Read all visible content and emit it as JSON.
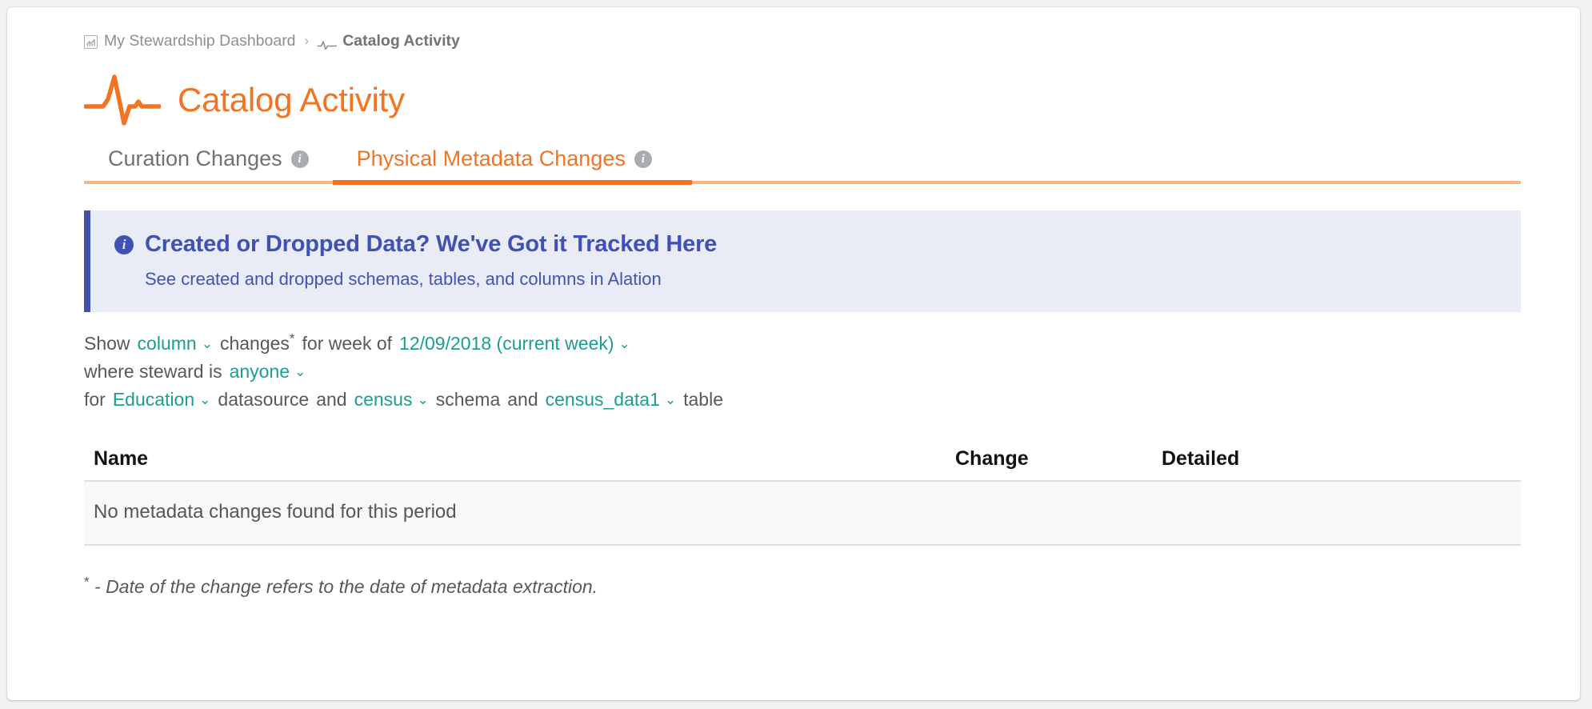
{
  "breadcrumb": {
    "dashboard_icon": "dashboard-chart-icon",
    "dashboard_label": "My Stewardship Dashboard",
    "separator": "›",
    "current_icon": "pulse-icon",
    "current_label": "Catalog Activity"
  },
  "header": {
    "icon": "pulse-icon",
    "title": "Catalog Activity",
    "accent_color": "#f37321"
  },
  "tabs": [
    {
      "label": "Curation Changes",
      "info": "i",
      "active": false
    },
    {
      "label": "Physical Metadata Changes",
      "info": "i",
      "active": true
    }
  ],
  "banner": {
    "icon": "info-circle-icon",
    "title": "Created or Dropped Data? We've Got it Tracked Here",
    "subtitle": "See created and dropped schemas, tables, and columns in Alation",
    "accent_color": "#3f51b5",
    "background_color": "#e9ecf7"
  },
  "filters": {
    "line1": {
      "show": "Show",
      "object_type": "column",
      "changes": "changes",
      "star": "*",
      "for_week_of": "for week of",
      "week": "12/09/2018 (current week)"
    },
    "line2": {
      "where_steward_is": "where steward is",
      "steward": "anyone"
    },
    "line3": {
      "for": "for",
      "datasource": "Education",
      "datasource_label": "datasource",
      "and1": "and",
      "schema": "census",
      "schema_label": "schema",
      "and2": "and",
      "table": "census_data1",
      "table_label": "table"
    },
    "chevron": "⌄",
    "link_color": "#1a9e8f"
  },
  "table": {
    "columns": [
      "Name",
      "Change",
      "Detailed"
    ],
    "rows": [],
    "empty_message": "No metadata changes found for this period"
  },
  "footnote": {
    "star": "*",
    "text": "- Date of the change refers to the date of metadata extraction."
  }
}
